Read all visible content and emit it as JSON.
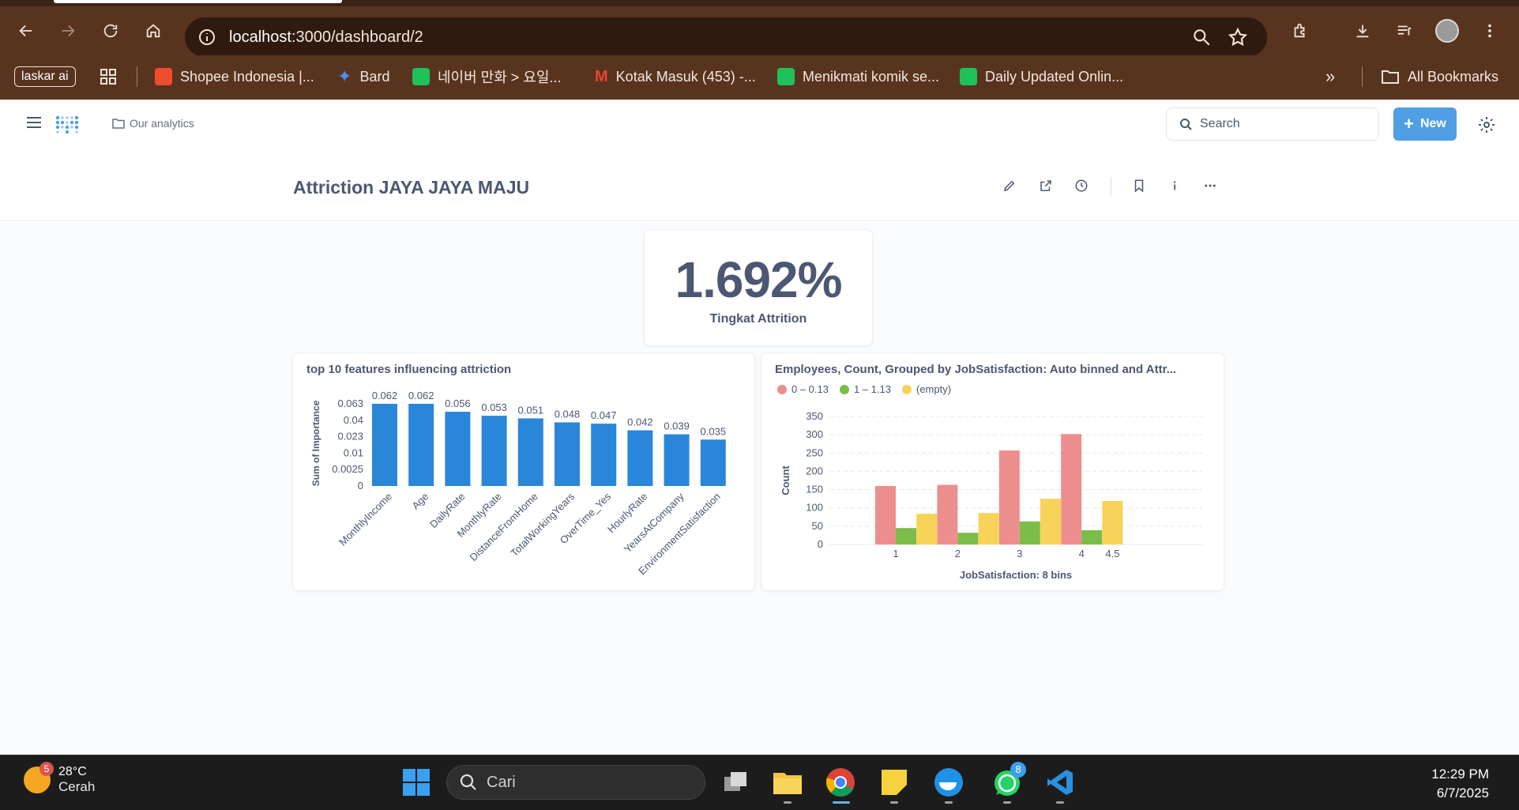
{
  "browser": {
    "url_host": "localhost",
    "url_path": ":3000/dashboard/2",
    "bookmarks": [
      {
        "label": "laskar ai"
      },
      {
        "label": "Shopee Indonesia |..."
      },
      {
        "label": "Bard"
      },
      {
        "label": "네이버 만화 > 요일..."
      },
      {
        "label": "Kotak Masuk (453) -..."
      },
      {
        "label": "Menikmati komik se..."
      },
      {
        "label": "Daily Updated Onlin..."
      }
    ],
    "all_bookmarks": "All Bookmarks"
  },
  "app": {
    "collection": "Our analytics",
    "search_placeholder": "Search",
    "new_label": "New"
  },
  "dashboard": {
    "title": "Attriction JAYA JAYA MAJU",
    "kpi": {
      "value": "1.692%",
      "label": "Tingkat Attrition"
    }
  },
  "chart_data": [
    {
      "type": "bar",
      "title": "top 10 features influencing attriction",
      "ylabel": "Sum of Importance",
      "categories": [
        "MonthlyIncome",
        "Age",
        "DailyRate",
        "MonthlyRate",
        "DistanceFromHome",
        "TotalWorkingYears",
        "OverTime_Yes",
        "HourlyRate",
        "YearsAtCompany",
        "EnvironmentSatisfaction"
      ],
      "values": [
        0.062,
        0.062,
        0.056,
        0.053,
        0.051,
        0.048,
        0.047,
        0.042,
        0.039,
        0.035
      ],
      "value_labels": [
        "0.062",
        "0.062",
        "0.056",
        "0.053",
        "0.051",
        "0.048",
        "0.047",
        "0.042",
        "0.039",
        "0.035"
      ],
      "yticks": [
        "0",
        "0.0025",
        "0.01",
        "0.023",
        "0.04",
        "0.063"
      ],
      "color": "#2a86d9"
    },
    {
      "type": "bar",
      "title": "Employees, Count, Grouped by JobSatisfaction: Auto binned and Attr...",
      "xlabel": "JobSatisfaction: 8 bins",
      "ylabel": "Count",
      "ylim": [
        0,
        350
      ],
      "yticks": [
        0,
        50,
        100,
        150,
        200,
        250,
        300,
        350
      ],
      "xticks": [
        "1",
        "2",
        "3",
        "4",
        "4.5"
      ],
      "bins": [
        1,
        1.5,
        2,
        2.5,
        3,
        3.5,
        4,
        4.5
      ],
      "series": [
        {
          "name": "0 – 0.13",
          "color": "#ed8e8e",
          "values": [
            160,
            null,
            163,
            null,
            257,
            null,
            302,
            null
          ]
        },
        {
          "name": "1 – 1.13",
          "color": "#7cbd4a",
          "values": [
            45,
            null,
            32,
            null,
            63,
            null,
            39,
            null
          ]
        },
        {
          "name": "(empty)",
          "color": "#f7d35a",
          "values": [
            null,
            84,
            null,
            86,
            null,
            125,
            null,
            119
          ]
        }
      ],
      "legend": "top-left"
    }
  ],
  "taskbar": {
    "weather_temp": "28°C",
    "weather_desc": "Cerah",
    "weather_badge": "5",
    "search_placeholder": "Cari",
    "whatsapp_badge": "8",
    "time": "12:29 PM",
    "date": "6/7/2025"
  }
}
